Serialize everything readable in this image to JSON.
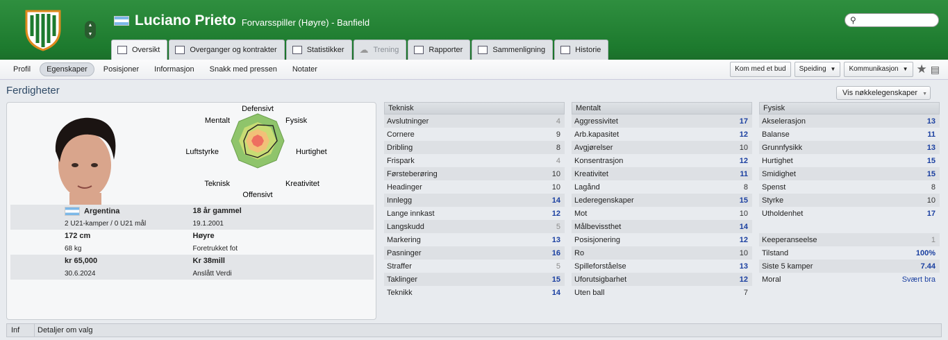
{
  "header": {
    "player_name": "Luciano Prieto",
    "role": "Forvarsspiller (Høyre) - Banfield",
    "nation_flag": "argentina-flag"
  },
  "tabs": [
    {
      "label": "Oversikt",
      "active": true
    },
    {
      "label": "Overganger og kontrakter"
    },
    {
      "label": "Statistikker"
    },
    {
      "label": "Trening",
      "disabled": true
    },
    {
      "label": "Rapporter"
    },
    {
      "label": "Sammenligning"
    },
    {
      "label": "Historie"
    }
  ],
  "subnav": [
    "Profil",
    "Egenskaper",
    "Posisjoner",
    "Informasjon",
    "Snakk med pressen",
    "Notater"
  ],
  "actions": {
    "offer": "Kom med et bud",
    "scouting": "Speiding",
    "communication": "Kommunikasjon"
  },
  "section_title": "Ferdigheter",
  "key_attr_button": "Vis nøkkelegenskaper",
  "radar_labels": {
    "defensive": "Defensivt",
    "physical": "Fysisk",
    "speed": "Hurtighet",
    "creativity": "Kreativitet",
    "offensive": "Offensivt",
    "technical": "Teknisk",
    "aerial": "Luftstyrke",
    "mental": "Mentalt"
  },
  "info": {
    "nation": "Argentina",
    "caps": "2 U21-kamper / 0 U21 mål",
    "age": "18 år gammel",
    "dob": "19.1.2001",
    "height": "172 cm",
    "weight": "68 kg",
    "foot": "Høyre",
    "foot_label": "Foretrukket fot",
    "wage": "kr 65,000",
    "contract_end": "30.6.2024",
    "value": "Kr 38mill",
    "value_label": "Anslått Verdi"
  },
  "technical": {
    "header": "Teknisk",
    "items": [
      {
        "name": "Avslutninger",
        "value": "4"
      },
      {
        "name": "Cornere",
        "value": "9"
      },
      {
        "name": "Dribling",
        "value": "8"
      },
      {
        "name": "Frispark",
        "value": "4"
      },
      {
        "name": "Førsteberøring",
        "value": "10"
      },
      {
        "name": "Headinger",
        "value": "10"
      },
      {
        "name": "Innlegg",
        "value": "14"
      },
      {
        "name": "Lange innkast",
        "value": "12"
      },
      {
        "name": "Langskudd",
        "value": "5"
      },
      {
        "name": "Markering",
        "value": "13"
      },
      {
        "name": "Pasninger",
        "value": "16"
      },
      {
        "name": "Straffer",
        "value": "5"
      },
      {
        "name": "Taklinger",
        "value": "15"
      },
      {
        "name": "Teknikk",
        "value": "14"
      }
    ]
  },
  "mental": {
    "header": "Mentalt",
    "items": [
      {
        "name": "Aggressivitet",
        "value": "17"
      },
      {
        "name": "Arb.kapasitet",
        "value": "12"
      },
      {
        "name": "Avgjørelser",
        "value": "10"
      },
      {
        "name": "Konsentrasjon",
        "value": "12"
      },
      {
        "name": "Kreativitet",
        "value": "11"
      },
      {
        "name": "Lagånd",
        "value": "8"
      },
      {
        "name": "Lederegenskaper",
        "value": "15"
      },
      {
        "name": "Mot",
        "value": "10"
      },
      {
        "name": "Målbevissthet",
        "value": "14"
      },
      {
        "name": "Posisjonering",
        "value": "12"
      },
      {
        "name": "Ro",
        "value": "10"
      },
      {
        "name": "Spilleforståelse",
        "value": "13"
      },
      {
        "name": "Uforutsigbarhet",
        "value": "12"
      },
      {
        "name": "Uten ball",
        "value": "7"
      }
    ]
  },
  "physical": {
    "header": "Fysisk",
    "items": [
      {
        "name": "Akselerasjon",
        "value": "13"
      },
      {
        "name": "Balanse",
        "value": "11"
      },
      {
        "name": "Grunnfysikk",
        "value": "13"
      },
      {
        "name": "Hurtighet",
        "value": "15"
      },
      {
        "name": "Smidighet",
        "value": "15"
      },
      {
        "name": "Spenst",
        "value": "8"
      },
      {
        "name": "Styrke",
        "value": "10"
      },
      {
        "name": "Utholdenhet",
        "value": "17"
      }
    ],
    "extra": [
      {
        "name": "Keeperanseelse",
        "value": "1"
      },
      {
        "name": "Tilstand",
        "value": "100%"
      },
      {
        "name": "Siste 5 kamper",
        "value": "7.44"
      },
      {
        "name": "Moral",
        "value": "Svært bra"
      }
    ]
  },
  "bottom": {
    "col1": "Inf",
    "col2": "Detaljer om valg"
  },
  "colors": {
    "header_green": "#1d7a2e",
    "value_blue": "#1a3fa0"
  }
}
